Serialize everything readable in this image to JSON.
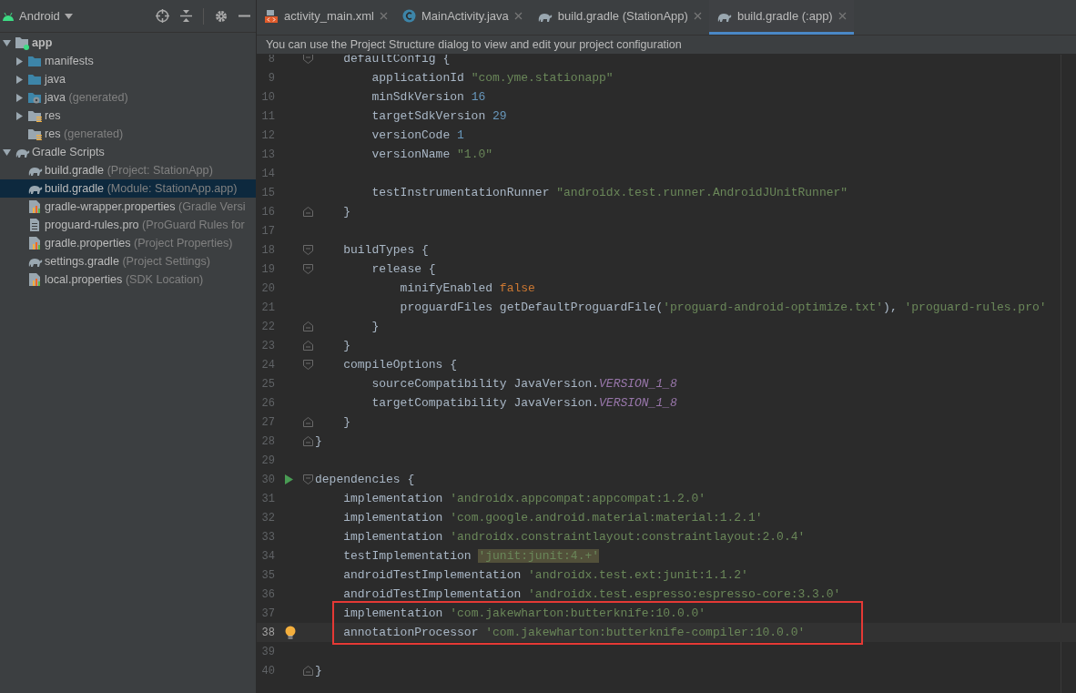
{
  "sidebar": {
    "header": {
      "title": "Android"
    },
    "tree": [
      {
        "label": "app",
        "kind": "module",
        "expanded": true,
        "selected": false,
        "children": [
          {
            "label": "manifests",
            "kind": "folder",
            "expanded": false,
            "selected": false
          },
          {
            "label": "java",
            "kind": "folder",
            "expanded": false,
            "selected": false
          },
          {
            "label": "java",
            "detail": "(generated)",
            "kind": "generated",
            "expanded": false,
            "selected": false
          },
          {
            "label": "res",
            "kind": "resources",
            "expanded": false,
            "selected": false
          },
          {
            "label": "res",
            "detail": "(generated)",
            "kind": "resources",
            "selected": false
          }
        ]
      },
      {
        "label": "Gradle Scripts",
        "kind": "gradle",
        "expanded": true,
        "selected": false,
        "children": [
          {
            "label": "build.gradle",
            "detail": "(Project: StationApp)",
            "kind": "gradle",
            "selected": false
          },
          {
            "label": "build.gradle",
            "detail": "(Module: StationApp.app)",
            "kind": "gradle",
            "selected": true
          },
          {
            "label": "gradle-wrapper.properties",
            "detail": "(Gradle Versi",
            "kind": "properties",
            "selected": false
          },
          {
            "label": "proguard-rules.pro",
            "detail": "(ProGuard Rules for",
            "kind": "text",
            "selected": false
          },
          {
            "label": "gradle.properties",
            "detail": "(Project Properties)",
            "kind": "properties",
            "selected": false
          },
          {
            "label": "settings.gradle",
            "detail": "(Project Settings)",
            "kind": "gradle",
            "selected": false
          },
          {
            "label": "local.properties",
            "detail": "(SDK Location)",
            "kind": "properties",
            "selected": false
          }
        ]
      }
    ]
  },
  "tabs": [
    {
      "label": "activity_main.xml",
      "kind": "xml",
      "selected": false
    },
    {
      "label": "MainActivity.java",
      "kind": "class",
      "selected": false
    },
    {
      "label": "build.gradle (StationApp)",
      "kind": "gradle",
      "selected": false
    },
    {
      "label": "build.gradle (:app)",
      "kind": "gradle",
      "selected": true
    }
  ],
  "banner": "You can use the Project Structure dialog to view and edit your project configuration",
  "editor": {
    "lines": [
      {
        "number": "8",
        "fold": {
          "kind": "start"
        },
        "current": false,
        "boxed": false,
        "tokens": [
          {
            "text": "    defaultConfig {",
            "kind": "plain"
          }
        ]
      },
      {
        "number": "9",
        "current": false,
        "boxed": false,
        "tokens": [
          {
            "text": "        applicationId ",
            "kind": "plain"
          },
          {
            "text": "\"com.yme.stationapp\"",
            "kind": "string"
          }
        ]
      },
      {
        "number": "10",
        "current": false,
        "boxed": false,
        "tokens": [
          {
            "text": "        minSdkVersion ",
            "kind": "plain"
          },
          {
            "text": "16",
            "kind": "number"
          }
        ]
      },
      {
        "number": "11",
        "current": false,
        "boxed": false,
        "tokens": [
          {
            "text": "        targetSdkVersion ",
            "kind": "plain"
          },
          {
            "text": "29",
            "kind": "number"
          }
        ]
      },
      {
        "number": "12",
        "current": false,
        "boxed": false,
        "tokens": [
          {
            "text": "        versionCode ",
            "kind": "plain"
          },
          {
            "text": "1",
            "kind": "number"
          }
        ]
      },
      {
        "number": "13",
        "current": false,
        "boxed": false,
        "tokens": [
          {
            "text": "        versionName ",
            "kind": "plain"
          },
          {
            "text": "\"1.0\"",
            "kind": "string"
          }
        ]
      },
      {
        "number": "14",
        "current": false,
        "boxed": false
      },
      {
        "number": "15",
        "current": false,
        "boxed": false,
        "tokens": [
          {
            "text": "        testInstrumentationRunner ",
            "kind": "plain"
          },
          {
            "text": "\"androidx.test.runner.AndroidJUnitRunner\"",
            "kind": "string"
          }
        ]
      },
      {
        "number": "16",
        "fold": {
          "kind": "end"
        },
        "current": false,
        "boxed": false,
        "tokens": [
          {
            "text": "    }",
            "kind": "plain"
          }
        ]
      },
      {
        "number": "17",
        "current": false,
        "boxed": false
      },
      {
        "number": "18",
        "fold": {
          "kind": "start"
        },
        "current": false,
        "boxed": false,
        "tokens": [
          {
            "text": "    buildTypes {",
            "kind": "plain"
          }
        ]
      },
      {
        "number": "19",
        "fold": {
          "kind": "start"
        },
        "current": false,
        "boxed": false,
        "tokens": [
          {
            "text": "        release {",
            "kind": "plain"
          }
        ]
      },
      {
        "number": "20",
        "current": false,
        "boxed": false,
        "tokens": [
          {
            "text": "            minifyEnabled ",
            "kind": "plain"
          },
          {
            "text": "false",
            "kind": "keyword"
          }
        ]
      },
      {
        "number": "21",
        "current": false,
        "boxed": false,
        "tokens": [
          {
            "text": "            proguardFiles getDefaultProguardFile(",
            "kind": "plain"
          },
          {
            "text": "'proguard-android-optimize.txt'",
            "kind": "string"
          },
          {
            "text": "), ",
            "kind": "plain"
          },
          {
            "text": "'proguard-rules.pro'",
            "kind": "string"
          }
        ]
      },
      {
        "number": "22",
        "fold": {
          "kind": "end"
        },
        "current": false,
        "boxed": false,
        "tokens": [
          {
            "text": "        }",
            "kind": "plain"
          }
        ]
      },
      {
        "number": "23",
        "fold": {
          "kind": "end"
        },
        "current": false,
        "boxed": false,
        "tokens": [
          {
            "text": "    }",
            "kind": "plain"
          }
        ]
      },
      {
        "number": "24",
        "fold": {
          "kind": "start"
        },
        "current": false,
        "boxed": false,
        "tokens": [
          {
            "text": "    compileOptions {",
            "kind": "plain"
          }
        ]
      },
      {
        "number": "25",
        "current": false,
        "boxed": false,
        "tokens": [
          {
            "text": "        sourceCompatibility JavaVersion.",
            "kind": "plain"
          },
          {
            "text": "VERSION_1_8",
            "kind": "constant"
          }
        ]
      },
      {
        "number": "26",
        "current": false,
        "boxed": false,
        "tokens": [
          {
            "text": "        targetCompatibility JavaVersion.",
            "kind": "plain"
          },
          {
            "text": "VERSION_1_8",
            "kind": "constant"
          }
        ]
      },
      {
        "number": "27",
        "fold": {
          "kind": "end"
        },
        "current": false,
        "boxed": false,
        "tokens": [
          {
            "text": "    }",
            "kind": "plain"
          }
        ]
      },
      {
        "number": "28",
        "fold": {
          "kind": "end"
        },
        "current": false,
        "boxed": false,
        "tokens": [
          {
            "text": "}",
            "kind": "plain"
          }
        ]
      },
      {
        "number": "29",
        "current": false,
        "boxed": false
      },
      {
        "number": "30",
        "fold": {
          "kind": "start"
        },
        "gutter": {
          "kind": "run"
        },
        "current": false,
        "boxed": false,
        "tokens": [
          {
            "text": "dependencies {",
            "kind": "plain"
          }
        ]
      },
      {
        "number": "31",
        "current": false,
        "boxed": false,
        "tokens": [
          {
            "text": "    implementation ",
            "kind": "plain"
          },
          {
            "text": "'androidx.appcompat:appcompat:1.2.0'",
            "kind": "string"
          }
        ]
      },
      {
        "number": "32",
        "current": false,
        "boxed": false,
        "tokens": [
          {
            "text": "    implementation ",
            "kind": "plain"
          },
          {
            "text": "'com.google.android.material:material:1.2.1'",
            "kind": "string"
          }
        ]
      },
      {
        "number": "33",
        "current": false,
        "boxed": false,
        "tokens": [
          {
            "text": "    implementation ",
            "kind": "plain"
          },
          {
            "text": "'androidx.constraintlayout:constraintlayout:2.0.4'",
            "kind": "string"
          }
        ]
      },
      {
        "number": "34",
        "current": false,
        "boxed": false,
        "tokens": [
          {
            "text": "    testImplementation ",
            "kind": "plain"
          },
          {
            "text": "'junit:junit:4.+'",
            "kind": "warning"
          }
        ]
      },
      {
        "number": "35",
        "current": false,
        "boxed": false,
        "tokens": [
          {
            "text": "    androidTestImplementation ",
            "kind": "plain"
          },
          {
            "text": "'androidx.test.ext:junit:1.1.2'",
            "kind": "string"
          }
        ]
      },
      {
        "number": "36",
        "current": false,
        "boxed": false,
        "tokens": [
          {
            "text": "    androidTestImplementation ",
            "kind": "plain"
          },
          {
            "text": "'androidx.test.espresso:espresso-core:3.3.0'",
            "kind": "string"
          }
        ]
      },
      {
        "number": "37",
        "current": false,
        "boxed": true,
        "tokens": [
          {
            "text": "    implementation ",
            "kind": "plain"
          },
          {
            "text": "'com.jakewharton:butterknife:10.0.0'",
            "kind": "string"
          }
        ]
      },
      {
        "number": "38",
        "gutter": {
          "kind": "bulb"
        },
        "current": true,
        "boxed": true,
        "tokens": [
          {
            "text": "    annotationProcessor ",
            "kind": "plain"
          },
          {
            "text": "'com.jakewharton:butterknife-compiler:10.0.0'",
            "kind": "string"
          }
        ]
      },
      {
        "number": "39",
        "current": false,
        "boxed": false
      },
      {
        "number": "40",
        "fold": {
          "kind": "end"
        },
        "current": false,
        "boxed": false,
        "tokens": [
          {
            "text": "}",
            "kind": "plain"
          }
        ]
      }
    ]
  }
}
